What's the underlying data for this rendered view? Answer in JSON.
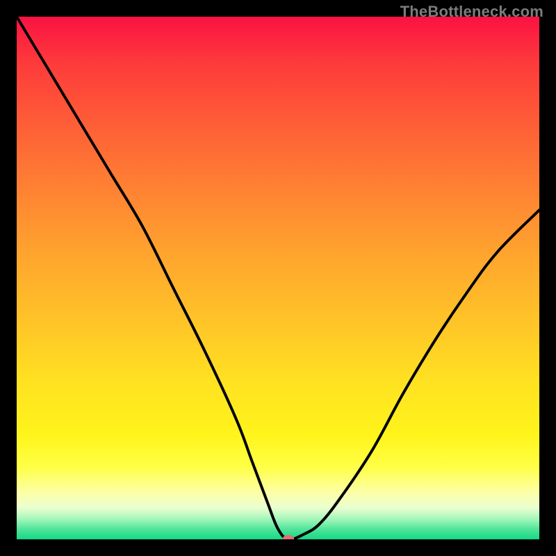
{
  "watermark": "TheBottleneck.com",
  "colors": {
    "page_bg": "#000000",
    "curve": "#000000",
    "marker": "#e46e72",
    "gradient_top": "#fb1242",
    "gradient_bottom": "#14d884"
  },
  "chart_data": {
    "type": "line",
    "title": "",
    "xlabel": "",
    "ylabel": "",
    "xlim": [
      0,
      100
    ],
    "ylim": [
      0,
      100
    ],
    "grid": false,
    "series": [
      {
        "name": "bottleneck-curve",
        "x": [
          0,
          6,
          12,
          18,
          24,
          30,
          36,
          42,
          45,
          48,
          50,
          52,
          55,
          58,
          62,
          68,
          74,
          80,
          86,
          92,
          100
        ],
        "values": [
          100,
          90,
          80,
          70,
          60,
          48,
          36,
          23,
          15,
          7,
          2,
          0,
          1,
          3,
          8,
          17,
          28,
          38,
          47,
          55,
          63
        ]
      }
    ],
    "marker": {
      "x": 52,
      "y": 0
    },
    "background_gradient": {
      "direction": "top-to-bottom",
      "stops": [
        {
          "pos": 0,
          "color": "#fb1242"
        },
        {
          "pos": 9,
          "color": "#fd3b3b"
        },
        {
          "pos": 20,
          "color": "#fe5c37"
        },
        {
          "pos": 32,
          "color": "#ff7f33"
        },
        {
          "pos": 45,
          "color": "#ffa32e"
        },
        {
          "pos": 58,
          "color": "#ffc328"
        },
        {
          "pos": 70,
          "color": "#ffe221"
        },
        {
          "pos": 80,
          "color": "#fff41b"
        },
        {
          "pos": 86,
          "color": "#ffff44"
        },
        {
          "pos": 91,
          "color": "#fdffa6"
        },
        {
          "pos": 94,
          "color": "#eaffd0"
        },
        {
          "pos": 96,
          "color": "#a8f7bc"
        },
        {
          "pos": 98,
          "color": "#52e59a"
        },
        {
          "pos": 100,
          "color": "#14d884"
        }
      ]
    }
  }
}
